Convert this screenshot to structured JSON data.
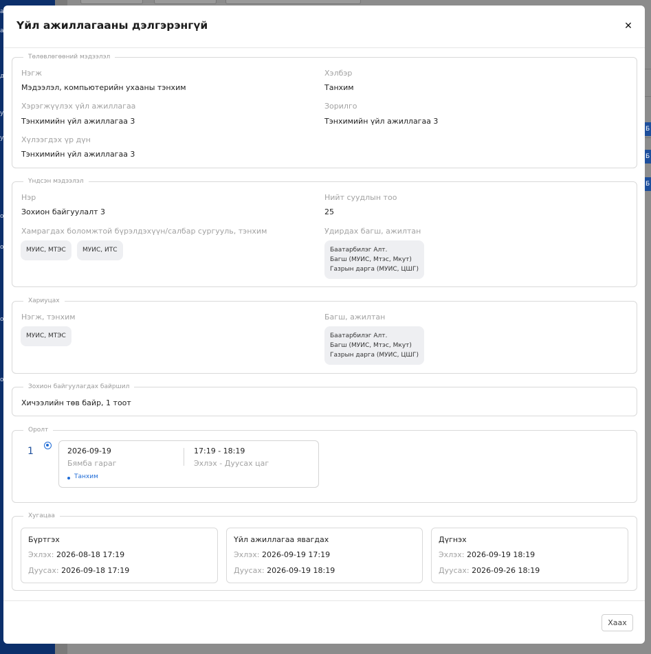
{
  "modal": {
    "title": "Үйл ажиллагааны дэлгэрэнгүй",
    "close_label": "Хаах"
  },
  "planning": {
    "legend": "Төлөвлөгөөний мэдээлэл",
    "unit_label": "Нэгж",
    "unit_value": "Мэдээлэл, компьютерийн ухааны тэнхим",
    "form_label": "Хэлбэр",
    "form_value": "Танхим",
    "activity_label": "Хэрэгжүүлэх үйл ажиллагаа",
    "activity_value": "Тэнхимийн үйл ажиллагаа 3",
    "goal_label": "Зорилго",
    "goal_value": "Тэнхимийн үйл ажиллагаа 3",
    "outcome_label": "Хүлээгдэх үр дүн",
    "outcome_value": "Тэнхимийн үйл ажиллагаа 3"
  },
  "basic": {
    "legend": "Үндсэн мэдээлэл",
    "name_label": "Нэр",
    "name_value": "Зохион байгуулалт 3",
    "seats_label": "Нийт суудлын тоо",
    "seats_value": "25",
    "scope_label": "Хамрагдах боломжтой бүрэлдэхүүн/салбар сургууль, тэнхим",
    "scope_chips": [
      "МУИС, МТЭС",
      "МУИС, ИТС"
    ],
    "lead_label": "Удирдах багш, ажилтан",
    "lead_lines": [
      "Баатарбилэг Алт.",
      "Багш (МУИС, Мтэс, Мкут)",
      "Газрын дарга (МУИС, ЦШГ)"
    ]
  },
  "responsible": {
    "legend": "Хариуцах",
    "unit_label": "Нэгж, тэнхим",
    "unit_chips": [
      "МУИС, МТЭС"
    ],
    "staff_label": "Багш, ажилтан",
    "staff_lines": [
      "Баатарбилэг Алт.",
      "Багш (МУИС, Мтэс, Мкут)",
      "Газрын дарга (МУИС, ЦШГ)"
    ]
  },
  "location": {
    "legend": "Зохион байгуулагдах байршил",
    "value": "Хичээлийн төв байр, 1 тоот"
  },
  "sessions": {
    "legend": "Оролт",
    "items": [
      {
        "number": "1",
        "date": "2026-09-19",
        "weekday": "Бямба гараг",
        "time": "17:19 - 18:19",
        "time_caption": "Эхлэх - Дуусах цаг",
        "mode": "Танхим"
      }
    ]
  },
  "periods": {
    "legend": "Хугацаа",
    "start_key": "Эхлэх:",
    "end_key": "Дуусах:",
    "items": [
      {
        "title": "Бүртгэх",
        "start": "2026-08-18 17:19",
        "end": "2026-09-18 17:19"
      },
      {
        "title": "Үйл ажиллагаа явагдах",
        "start": "2026-09-19 17:19",
        "end": "2026-09-19 18:19"
      },
      {
        "title": "Дүгнэх",
        "start": "2026-09-19 18:19",
        "end": "2026-09-26 18:19"
      }
    ]
  },
  "background": {
    "side_stub_text": "Б",
    "left_letters": [
      "а",
      "а",
      "д",
      "у",
      "у",
      "о",
      "о",
      "о",
      "о"
    ]
  }
}
